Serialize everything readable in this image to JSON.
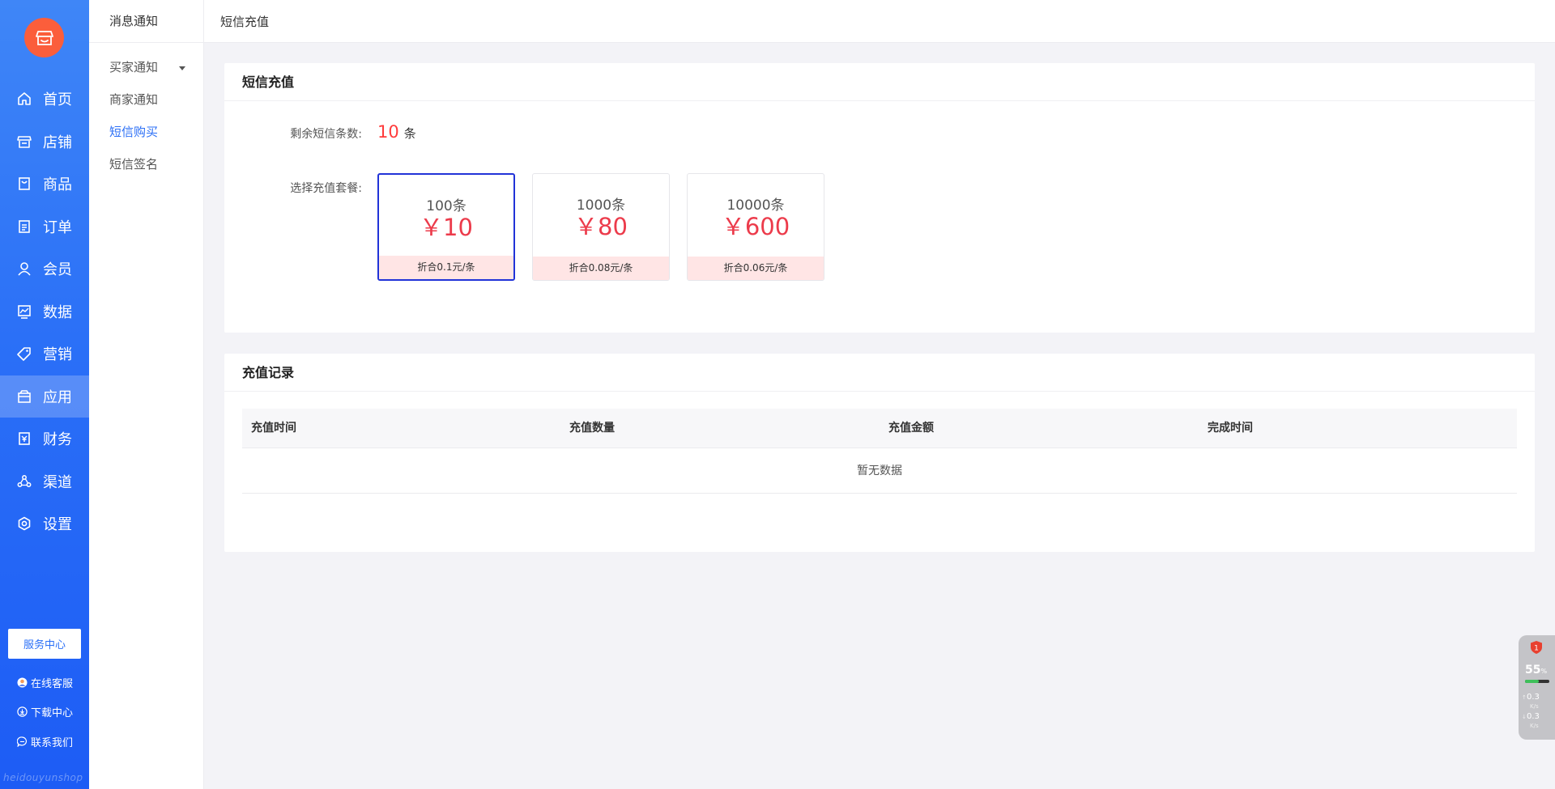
{
  "nav": {
    "items": [
      {
        "label": "首页",
        "icon": "home-icon"
      },
      {
        "label": "店铺",
        "icon": "store-icon"
      },
      {
        "label": "商品",
        "icon": "goods-icon"
      },
      {
        "label": "订单",
        "icon": "order-icon"
      },
      {
        "label": "会员",
        "icon": "member-icon"
      },
      {
        "label": "数据",
        "icon": "data-icon"
      },
      {
        "label": "营销",
        "icon": "tag-icon"
      },
      {
        "label": "应用",
        "icon": "app-icon",
        "active": true
      },
      {
        "label": "财务",
        "icon": "finance-icon"
      },
      {
        "label": "渠道",
        "icon": "channel-icon"
      },
      {
        "label": "设置",
        "icon": "settings-icon"
      }
    ],
    "service_center": "服务中心",
    "online_service": "在线客服",
    "download_center": "下载中心",
    "contact_us": "联系我们",
    "watermark": "heidouyunshop"
  },
  "subnav": {
    "title": "消息通知",
    "items": [
      {
        "label": "买家通知"
      },
      {
        "label": "商家通知"
      },
      {
        "label": "短信购买",
        "active": true
      },
      {
        "label": "短信签名"
      }
    ]
  },
  "topbar": {
    "title": "短信充值"
  },
  "recharge": {
    "title": "短信充值",
    "remain_label": "剩余短信条数:",
    "remain_value": "10",
    "remain_unit": "条",
    "package_label": "选择充值套餐:",
    "packages": [
      {
        "count": "100条",
        "price": "￥10",
        "unit_price": "折合0.1元/条",
        "selected": true
      },
      {
        "count": "1000条",
        "price": "￥80",
        "unit_price": "折合0.08元/条"
      },
      {
        "count": "10000条",
        "price": "￥600",
        "unit_price": "折合0.06元/条"
      }
    ]
  },
  "records": {
    "title": "充值记录",
    "columns": [
      "充值时间",
      "充值数量",
      "充值金额",
      "完成时间"
    ],
    "empty_text": "暂无数据"
  },
  "monitor": {
    "badge": "1",
    "percent": "55",
    "percent_unit": "%",
    "upload": "0.3",
    "download": "0.3",
    "speed_unit": "K/s",
    "usage_fraction": 0.55
  },
  "colors": {
    "nav_blue": "#2a6ff7",
    "logo_orange": "#fb5e3b",
    "price_red": "#ec3b4b",
    "selected_border": "#2133d8",
    "active_link": "#2b6ff6"
  }
}
